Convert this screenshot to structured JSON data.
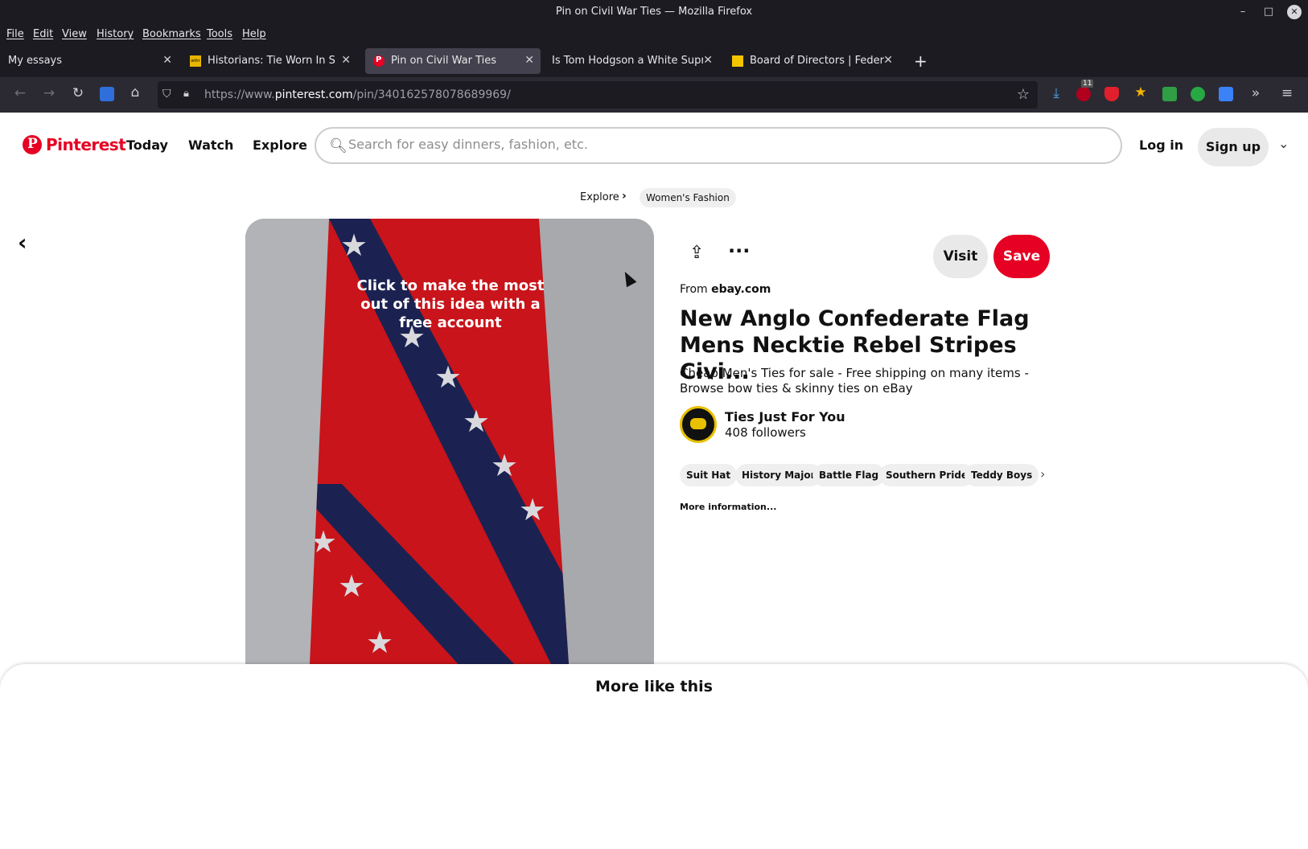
{
  "window": {
    "title": "Pin on Civil War Ties — Mozilla Firefox",
    "controls": {
      "minimize": "–",
      "maximize": "□",
      "close": "✕"
    }
  },
  "menu": [
    "File",
    "Edit",
    "View",
    "History",
    "Bookmarks",
    "Tools",
    "Help"
  ],
  "tabs": [
    {
      "label": "My essays",
      "close": "✕"
    },
    {
      "label": "Historians: Tie Worn In Sher",
      "close": "✕",
      "favicon": "wthr"
    },
    {
      "label": "Pin on Civil War Ties",
      "close": "✕"
    },
    {
      "label": "Is Tom Hodgson a White Suprem",
      "close": "✕"
    },
    {
      "label": "Board of Directors | Federat",
      "close": "✕"
    }
  ],
  "new_tab": "+",
  "url": {
    "prefix": "https://www.",
    "domain": "pinterest.com",
    "path": "/pin/340162578078689969/"
  },
  "toolbar_badge": "11",
  "pinterest": {
    "brand": "Pinterest",
    "nav": [
      "Today",
      "Watch",
      "Explore"
    ],
    "search_placeholder": "Search for easy dinners, fashion, etc.",
    "login": "Log in",
    "signup": "Sign up"
  },
  "breadcrumb": {
    "root": "Explore",
    "current": "Women's Fashion"
  },
  "pin": {
    "overlay": "Click to make the most out of this idea with a free account",
    "visit": "Visit",
    "save": "Save",
    "from_label": "From",
    "from_domain": "ebay.com",
    "title": "New Anglo Confederate Flag Mens Necktie Rebel Stripes Civi...",
    "description": "Cheap Men's Ties for sale - Free shipping on many items - Browse bow ties & skinny ties on eBay",
    "creator_name": "Ties Just For You",
    "creator_followers": "408 followers",
    "tags": [
      "Suit Hat",
      "History Major",
      "Battle Flag",
      "Southern Pride",
      "Teddy Boys"
    ],
    "more_info": "More information..."
  },
  "more_like_this": "More like this",
  "colors": {
    "brand": "#e60023",
    "chrome": "#1c1b22",
    "toolbar": "#2b2a33",
    "tie_red": "#c8141a",
    "stripe_navy": "#1b2252"
  }
}
